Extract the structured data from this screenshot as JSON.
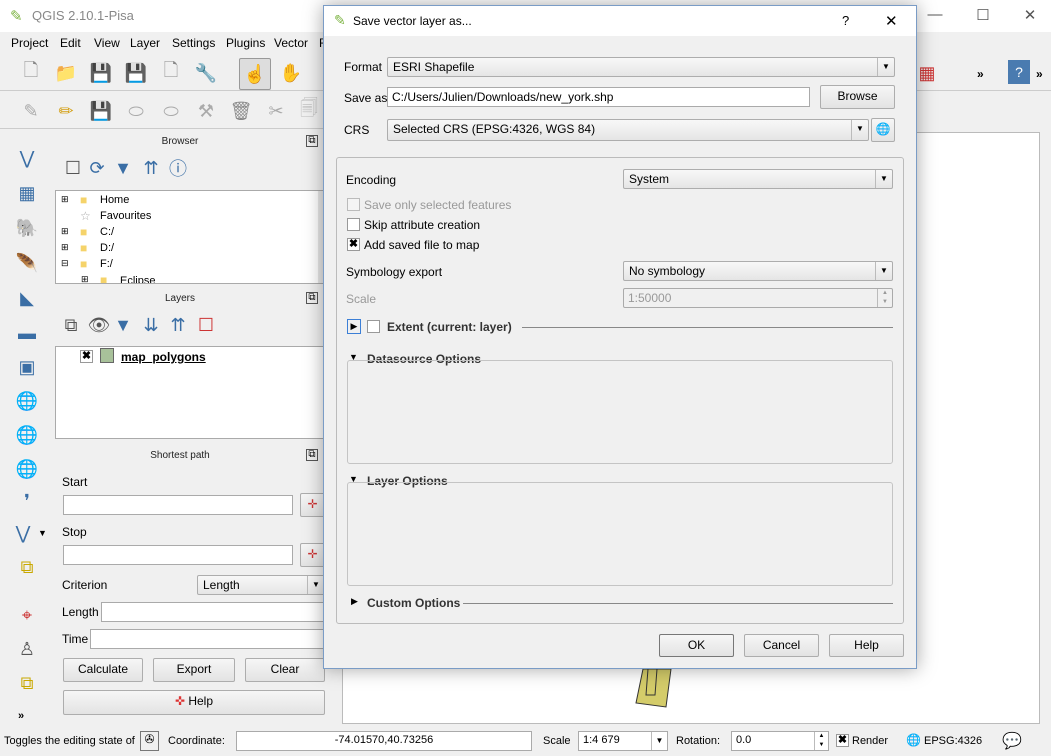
{
  "app": {
    "title": "QGIS 2.10.1-Pisa"
  },
  "menu": [
    "Project",
    "Edit",
    "View",
    "Layer",
    "Settings",
    "Plugins",
    "Vector",
    "R"
  ],
  "browser": {
    "title": "Browser",
    "items": [
      "Home",
      "Favourites",
      "C:/",
      "D:/",
      "F:/",
      "Eclipse"
    ]
  },
  "layers": {
    "title": "Layers",
    "items": [
      {
        "name": "map_polygons",
        "checked": true,
        "color": "#a8c19a"
      }
    ]
  },
  "shortest_path": {
    "title": "Shortest path",
    "start_label": "Start",
    "stop_label": "Stop",
    "criterion_label": "Criterion",
    "criterion_value": "Length",
    "length_label": "Length",
    "time_label": "Time",
    "calculate": "Calculate",
    "export": "Export",
    "clear": "Clear",
    "help": "Help"
  },
  "dialog": {
    "title": "Save vector layer as...",
    "help_glyph": "?",
    "close_glyph": "✕",
    "format_label": "Format",
    "format_value": "ESRI Shapefile",
    "saveas_label": "Save as",
    "saveas_value": "C:/Users/Julien/Downloads/new_york.shp",
    "browse": "Browse",
    "crs_label": "CRS",
    "crs_value": "Selected CRS (EPSG:4326, WGS 84)",
    "encoding_label": "Encoding",
    "encoding_value": "System",
    "save_selected": "Save only selected features",
    "skip_attr": "Skip attribute creation",
    "add_to_map": "Add saved file to map",
    "symbology_label": "Symbology export",
    "symbology_value": "No symbology",
    "scale_label": "Scale",
    "scale_value": "1:50000",
    "extent": "Extent (current: layer)",
    "datasource": "Datasource Options",
    "layer_options": "Layer Options",
    "custom_options": "Custom Options",
    "ok": "OK",
    "cancel": "Cancel",
    "help": "Help"
  },
  "status": {
    "message": "Toggles the editing state of",
    "coordinate_label": "Coordinate:",
    "coordinate": "-74.01570,40.73256",
    "scale_label": "Scale",
    "scale": "1:4 679",
    "rotation_label": "Rotation:",
    "rotation": "0.0",
    "render": "Render",
    "crs": "EPSG:4326"
  }
}
